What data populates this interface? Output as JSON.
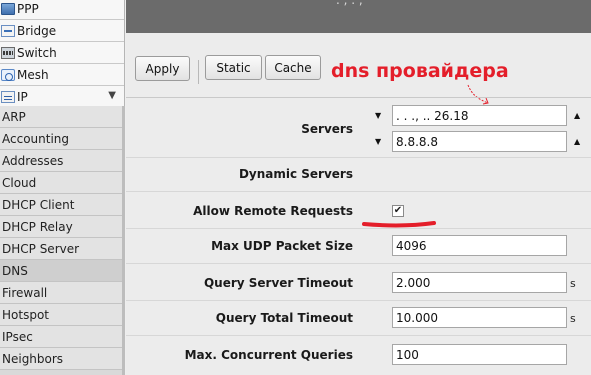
{
  "sidebar": {
    "items": [
      {
        "label": "PPP",
        "icon": "ppp-icon"
      },
      {
        "label": "Bridge",
        "icon": "bridge-icon"
      },
      {
        "label": "Switch",
        "icon": "switch-icon"
      },
      {
        "label": "Mesh",
        "icon": "mesh-icon"
      },
      {
        "label": "IP",
        "icon": "ip-icon",
        "expand_indicator": "▼"
      }
    ],
    "ip_subitems": [
      "ARP",
      "Accounting",
      "Addresses",
      "Cloud",
      "DHCP Client",
      "DHCP Relay",
      "DHCP Server",
      "DNS",
      "Firewall",
      "Hotspot",
      "IPsec",
      "Neighbors"
    ],
    "active_subitem": "DNS"
  },
  "header": {
    "partial_text": ". , . ,"
  },
  "toolbar": {
    "apply_label": "Apply",
    "static_label": "Static",
    "cache_label": "Cache"
  },
  "annotation": {
    "text": "dns провайдера",
    "color": "#e41e2a"
  },
  "form": {
    "servers_label": "Servers",
    "server_1_value": ". . ., .. 26.18",
    "server_2_value": "8.8.8.8",
    "dynamic_servers_label": "Dynamic Servers",
    "allow_remote_label": "Allow Remote Requests",
    "allow_remote_checked": true,
    "checkmark": "✔",
    "max_udp_label": "Max UDP Packet Size",
    "max_udp_value": "4096",
    "query_server_timeout_label": "Query Server Timeout",
    "query_server_timeout_value": "2.000",
    "query_server_timeout_unit": "s",
    "query_total_timeout_label": "Query Total Timeout",
    "query_total_timeout_value": "10.000",
    "query_total_timeout_unit": "s",
    "max_concurrent_label": "Max. Concurrent Queries",
    "max_concurrent_value": "100"
  },
  "glyphs": {
    "down_arrow": "▼",
    "up_arrow": "▲"
  },
  "colors": {
    "annotation_red": "#e41e2a",
    "header_gray": "#6b6b6b"
  }
}
